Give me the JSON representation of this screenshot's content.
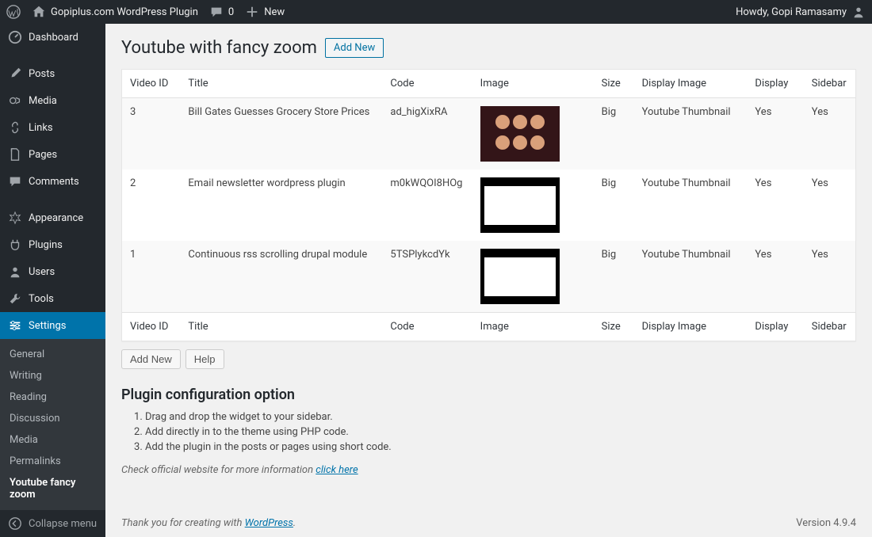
{
  "adminbar": {
    "site_title": "Gopiplus.com WordPress Plugin",
    "comments": "0",
    "new": "New",
    "howdy": "Howdy, Gopi Ramasamy"
  },
  "sidebar": {
    "dashboard": "Dashboard",
    "posts": "Posts",
    "media": "Media",
    "links": "Links",
    "pages": "Pages",
    "comments": "Comments",
    "appearance": "Appearance",
    "plugins": "Plugins",
    "users": "Users",
    "tools": "Tools",
    "settings": "Settings",
    "submenu": {
      "general": "General",
      "writing": "Writing",
      "reading": "Reading",
      "discussion": "Discussion",
      "media": "Media",
      "permalinks": "Permalinks",
      "youtube": "Youtube fancy zoom"
    },
    "collapse": "Collapse menu"
  },
  "page": {
    "title": "Youtube with fancy zoom",
    "add_new": "Add New"
  },
  "table": {
    "headers": {
      "video_id": "Video ID",
      "title": "Title",
      "code": "Code",
      "image": "Image",
      "size": "Size",
      "display_image": "Display Image",
      "display": "Display",
      "sidebar": "Sidebar"
    },
    "rows": [
      {
        "id": "3",
        "title": "Bill Gates Guesses Grocery Store Prices",
        "code": "ad_higXixRA",
        "size": "Big",
        "dimage": "Youtube Thumbnail",
        "display": "Yes",
        "sidebar": "Yes",
        "thumb": "audience"
      },
      {
        "id": "2",
        "title": "Email newsletter wordpress plugin",
        "code": "m0kWQOI8HOg",
        "size": "Big",
        "dimage": "Youtube Thumbnail",
        "display": "Yes",
        "sidebar": "Yes",
        "thumb": "doc"
      },
      {
        "id": "1",
        "title": "Continuous rss scrolling drupal module",
        "code": "5TSPlykcdYk",
        "size": "Big",
        "dimage": "Youtube Thumbnail",
        "display": "Yes",
        "sidebar": "Yes",
        "thumb": "doc"
      }
    ]
  },
  "buttons": {
    "add_new": "Add New",
    "help": "Help"
  },
  "config": {
    "heading": "Plugin configuration option",
    "items": [
      "Drag and drop the widget to your sidebar.",
      "Add directly in to the theme using PHP code.",
      "Add the plugin in the posts or pages using short code."
    ],
    "info_prefix": "Check official website for more information ",
    "info_link": "click here"
  },
  "footer": {
    "thanks_prefix": "Thank you for creating with ",
    "wordpress": "WordPress",
    "version": "Version 4.9.4"
  }
}
